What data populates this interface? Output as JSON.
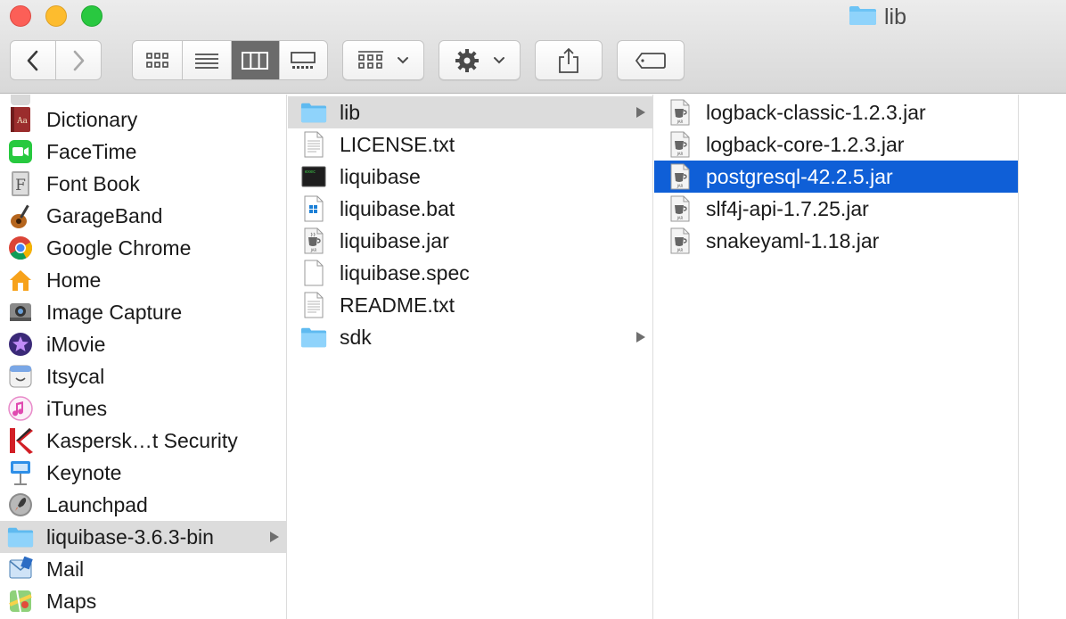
{
  "window": {
    "title": "lib"
  },
  "toolbar": {
    "back_icon": "chevron-left-icon",
    "forward_icon": "chevron-right-icon",
    "view_modes": [
      "icon-view",
      "list-view",
      "column-view",
      "gallery-view"
    ],
    "active_view": "column-view"
  },
  "sidebar_column": {
    "items": [
      {
        "label": "Dictionary",
        "icon": "dictionary-app-icon"
      },
      {
        "label": "FaceTime",
        "icon": "facetime-app-icon"
      },
      {
        "label": "Font Book",
        "icon": "font-book-app-icon"
      },
      {
        "label": "GarageBand",
        "icon": "garageband-app-icon"
      },
      {
        "label": "Google Chrome",
        "icon": "chrome-app-icon"
      },
      {
        "label": "Home",
        "icon": "home-app-icon"
      },
      {
        "label": "Image Capture",
        "icon": "image-capture-app-icon"
      },
      {
        "label": "iMovie",
        "icon": "imovie-app-icon"
      },
      {
        "label": "Itsycal",
        "icon": "itsycal-app-icon"
      },
      {
        "label": "iTunes",
        "icon": "itunes-app-icon"
      },
      {
        "label": "Kaspersk…t Security",
        "icon": "kaspersky-app-icon"
      },
      {
        "label": "Keynote",
        "icon": "keynote-app-icon"
      },
      {
        "label": "Launchpad",
        "icon": "launchpad-app-icon"
      },
      {
        "label": "liquibase-3.6.3-bin",
        "icon": "folder-icon",
        "selected": true,
        "has_children": true
      },
      {
        "label": "Mail",
        "icon": "mail-app-icon"
      },
      {
        "label": "Maps",
        "icon": "maps-app-icon"
      }
    ]
  },
  "folder_column": {
    "items": [
      {
        "label": "lib",
        "icon": "folder-icon",
        "selected": true,
        "has_children": true
      },
      {
        "label": "LICENSE.txt",
        "icon": "text-file-icon"
      },
      {
        "label": "liquibase",
        "icon": "terminal-exec-icon"
      },
      {
        "label": "liquibase.bat",
        "icon": "bat-file-icon"
      },
      {
        "label": "liquibase.jar",
        "icon": "jar-file-icon"
      },
      {
        "label": "liquibase.spec",
        "icon": "blank-file-icon"
      },
      {
        "label": "README.txt",
        "icon": "text-file-icon"
      },
      {
        "label": "sdk",
        "icon": "folder-icon",
        "has_children": true
      }
    ]
  },
  "lib_column": {
    "items": [
      {
        "label": "logback-classic-1.2.3.jar",
        "icon": "jar-file-icon"
      },
      {
        "label": "logback-core-1.2.3.jar",
        "icon": "jar-file-icon"
      },
      {
        "label": "postgresql-42.2.5.jar",
        "icon": "jar-file-icon",
        "selected": true
      },
      {
        "label": "slf4j-api-1.7.25.jar",
        "icon": "jar-file-icon"
      },
      {
        "label": "snakeyaml-1.18.jar",
        "icon": "jar-file-icon"
      }
    ]
  },
  "colors": {
    "selection_active": "#0f5fd7",
    "selection_inactive": "#dcdcdc",
    "folder": "#6cc3f5"
  }
}
